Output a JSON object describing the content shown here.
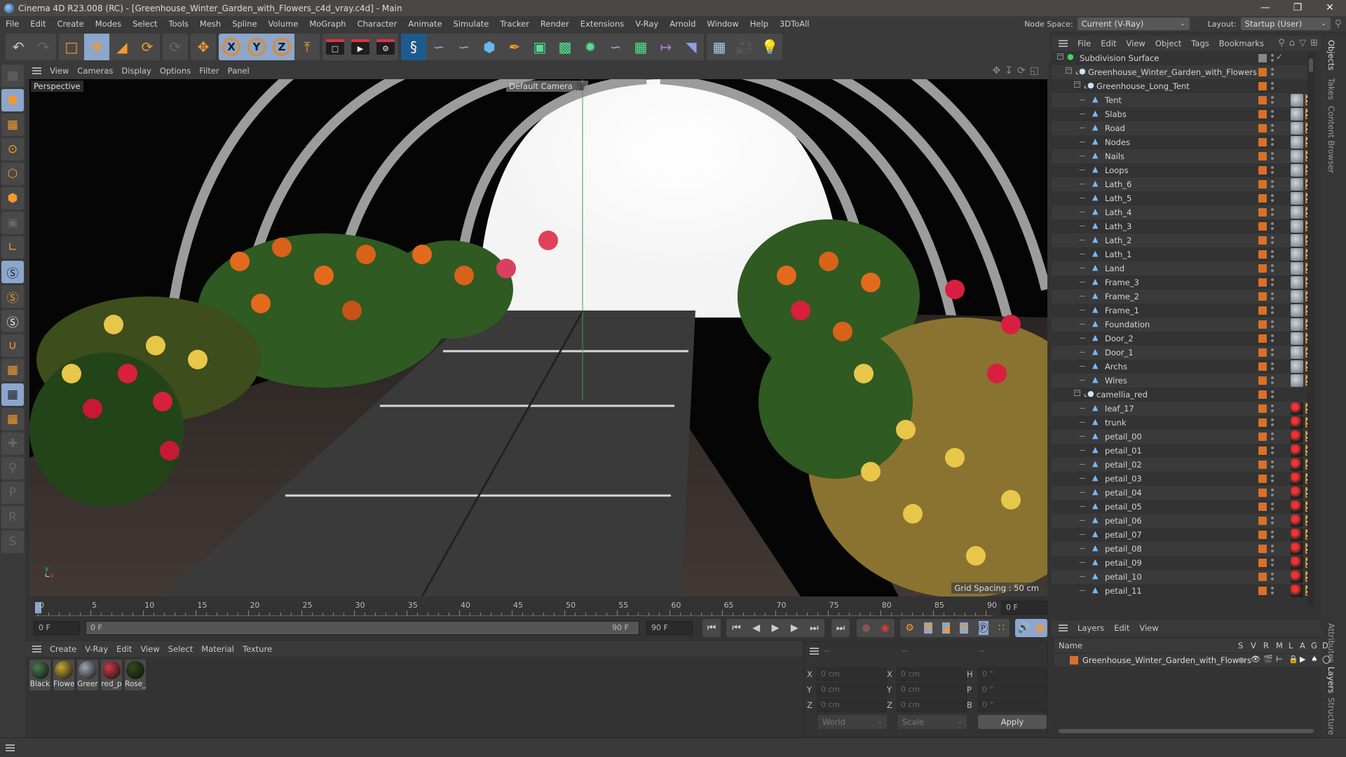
{
  "window": {
    "title": "Cinema 4D R23.008 (RC) - [Greenhouse_Winter_Garden_with_Flowers_c4d_vray.c4d] - Main",
    "controls": [
      "minimize",
      "restore",
      "close"
    ]
  },
  "menubar": {
    "items": [
      "File",
      "Edit",
      "Create",
      "Modes",
      "Select",
      "Tools",
      "Mesh",
      "Spline",
      "Volume",
      "MoGraph",
      "Character",
      "Animate",
      "Simulate",
      "Tracker",
      "Render",
      "Extensions",
      "V-Ray",
      "Arnold",
      "Window",
      "Help",
      "3DToAll"
    ],
    "node_space_label": "Node Space:",
    "node_space_value": "Current (V-Ray)",
    "layout_label": "Layout:",
    "layout_value": "Startup (User)"
  },
  "toolbar": {
    "groups": [
      [
        "undo-icon",
        "redo-icon"
      ],
      [
        "live-selection-icon",
        "move-icon",
        "scale-icon",
        "rotate-icon"
      ],
      [
        "psr-icon"
      ],
      [
        "axis-move-icon"
      ],
      [
        "x-axis-lock-icon",
        "y-axis-lock-icon",
        "z-axis-lock-icon",
        "coordinate-system-icon"
      ],
      [
        "render-view-icon",
        "render-picture-viewer-icon",
        "render-settings-icon"
      ],
      [
        "vray-icon",
        "python-icon",
        "python-icon",
        "cube-icon",
        "pen-icon",
        "subdivision-icon",
        "extrude-icon",
        "cloner-icon",
        "python-icon",
        "mograph-icon",
        "symmetry-icon",
        "deformer-icon"
      ],
      [
        "floor-icon",
        "camera-icon",
        "light-icon"
      ]
    ],
    "axis_labels": [
      "X",
      "Y",
      "Z"
    ]
  },
  "left_tools": [
    "make-editable-icon",
    "model-mode-icon",
    "texture-mode-icon",
    "point-mode-icon",
    "edge-mode-icon",
    "polygon-mode-icon",
    "uv-mode-icon",
    "axis-mode-icon",
    "snap-icon",
    "snap-settings-icon",
    "snap-quantize-icon",
    "magnet-icon",
    "workplane-icon",
    "locked-workplane-icon",
    "workplane-align-icon",
    "add-pin-icon",
    "pin-icon",
    "pin-p-icon",
    "pin-r-icon",
    "pin-s-icon"
  ],
  "viewport": {
    "menu": [
      "View",
      "Cameras",
      "Display",
      "Options",
      "Filter",
      "Panel"
    ],
    "view_name": "Perspective",
    "camera": "Default Camera",
    "grid_spacing": "Grid Spacing : 50 cm",
    "nav_icons": [
      "move-view-icon",
      "zoom-view-icon",
      "rotate-view-icon",
      "maximize-view-icon"
    ]
  },
  "timeline": {
    "ticks": [
      "0",
      "5",
      "10",
      "15",
      "20",
      "25",
      "30",
      "35",
      "40",
      "45",
      "50",
      "55",
      "60",
      "65",
      "70",
      "75",
      "80",
      "85",
      "90"
    ],
    "current_frame": "0 F",
    "start_field": "0 F",
    "range_start": "0 F",
    "range_end": "90 F",
    "end_field": "90 F"
  },
  "transport": {
    "buttons": [
      "go-to-start-icon",
      "prev-key-icon",
      "prev-frame-icon",
      "play-icon",
      "next-frame-icon",
      "next-key-icon",
      "go-to-end-icon",
      "record-key-icon",
      "autokey-icon",
      "keyframe-settings-icon",
      "key-position-icon",
      "key-scale-icon",
      "key-rotation-icon",
      "key-param-icon",
      "key-pla-icon",
      "sound-icon",
      "timeline-icon"
    ]
  },
  "materials": {
    "menu": [
      "Create",
      "V-Ray",
      "Edit",
      "View",
      "Select",
      "Material",
      "Texture"
    ],
    "items": [
      {
        "label": "Black",
        "color": "#4d7a4a"
      },
      {
        "label": "Flowe",
        "color": "#c9a833"
      },
      {
        "label": "Greer",
        "color": "#9aa7b0"
      },
      {
        "label": "red_p",
        "color": "#d03a48"
      },
      {
        "label": "Rose_",
        "color": "#2f4a1a"
      }
    ]
  },
  "coordinates": {
    "header": [
      "--",
      "--",
      "--"
    ],
    "position": [
      {
        "axis": "X",
        "value": "0 cm"
      },
      {
        "axis": "Y",
        "value": "0 cm"
      },
      {
        "axis": "Z",
        "value": "0 cm"
      }
    ],
    "size": [
      {
        "axis": "X",
        "value": "0 cm"
      },
      {
        "axis": "Y",
        "value": "0 cm"
      },
      {
        "axis": "Z",
        "value": "0 cm"
      }
    ],
    "rotation": [
      {
        "axis": "H",
        "value": "0 °"
      },
      {
        "axis": "P",
        "value": "0 °"
      },
      {
        "axis": "B",
        "value": "0 °"
      }
    ],
    "space": "World",
    "mode": "Scale",
    "apply_label": "Apply"
  },
  "object_manager": {
    "menu": [
      "File",
      "Edit",
      "View",
      "Object",
      "Tags",
      "Bookmarks"
    ],
    "objects": [
      {
        "name": "Subdivision Surface",
        "level": 0,
        "type": "subdivision",
        "tags": "check"
      },
      {
        "name": "Greenhouse_Winter_Garden_with_Flowers",
        "level": 1,
        "type": "null",
        "tags": "none"
      },
      {
        "name": "Greenhouse_Long_Tent",
        "level": 2,
        "type": "null",
        "tags": "none"
      },
      {
        "name": "Tent",
        "level": 3,
        "type": "mesh",
        "tags": "grey"
      },
      {
        "name": "Slabs",
        "level": 3,
        "type": "mesh",
        "tags": "grey"
      },
      {
        "name": "Road",
        "level": 3,
        "type": "mesh",
        "tags": "grey"
      },
      {
        "name": "Nodes",
        "level": 3,
        "type": "mesh",
        "tags": "grey"
      },
      {
        "name": "Nails",
        "level": 3,
        "type": "mesh",
        "tags": "grey"
      },
      {
        "name": "Loops",
        "level": 3,
        "type": "mesh",
        "tags": "grey"
      },
      {
        "name": "Lath_6",
        "level": 3,
        "type": "mesh",
        "tags": "grey"
      },
      {
        "name": "Lath_5",
        "level": 3,
        "type": "mesh",
        "tags": "grey"
      },
      {
        "name": "Lath_4",
        "level": 3,
        "type": "mesh",
        "tags": "grey"
      },
      {
        "name": "Lath_3",
        "level": 3,
        "type": "mesh",
        "tags": "grey"
      },
      {
        "name": "Lath_2",
        "level": 3,
        "type": "mesh",
        "tags": "grey"
      },
      {
        "name": "Lath_1",
        "level": 3,
        "type": "mesh",
        "tags": "grey"
      },
      {
        "name": "Land",
        "level": 3,
        "type": "mesh",
        "tags": "grey"
      },
      {
        "name": "Frame_3",
        "level": 3,
        "type": "mesh",
        "tags": "grey"
      },
      {
        "name": "Frame_2",
        "level": 3,
        "type": "mesh",
        "tags": "grey"
      },
      {
        "name": "Frame_1",
        "level": 3,
        "type": "mesh",
        "tags": "grey"
      },
      {
        "name": "Foundation",
        "level": 3,
        "type": "mesh",
        "tags": "grey"
      },
      {
        "name": "Door_2",
        "level": 3,
        "type": "mesh",
        "tags": "grey"
      },
      {
        "name": "Door_1",
        "level": 3,
        "type": "mesh",
        "tags": "grey"
      },
      {
        "name": "Archs",
        "level": 3,
        "type": "mesh",
        "tags": "grey"
      },
      {
        "name": "Wires",
        "level": 3,
        "type": "mesh",
        "tags": "grey"
      },
      {
        "name": "camellia_red",
        "level": 2,
        "type": "null",
        "tags": "none"
      },
      {
        "name": "leaf_17",
        "level": 3,
        "type": "mesh",
        "tags": "red"
      },
      {
        "name": "trunk",
        "level": 3,
        "type": "mesh",
        "tags": "red"
      },
      {
        "name": "petail_00",
        "level": 3,
        "type": "mesh",
        "tags": "red"
      },
      {
        "name": "petail_01",
        "level": 3,
        "type": "mesh",
        "tags": "red"
      },
      {
        "name": "petail_02",
        "level": 3,
        "type": "mesh",
        "tags": "red"
      },
      {
        "name": "petail_03",
        "level": 3,
        "type": "mesh",
        "tags": "red"
      },
      {
        "name": "petail_04",
        "level": 3,
        "type": "mesh",
        "tags": "red"
      },
      {
        "name": "petail_05",
        "level": 3,
        "type": "mesh",
        "tags": "red"
      },
      {
        "name": "petail_06",
        "level": 3,
        "type": "mesh",
        "tags": "red"
      },
      {
        "name": "petail_07",
        "level": 3,
        "type": "mesh",
        "tags": "red"
      },
      {
        "name": "petail_08",
        "level": 3,
        "type": "mesh",
        "tags": "red"
      },
      {
        "name": "petail_09",
        "level": 3,
        "type": "mesh",
        "tags": "red"
      },
      {
        "name": "petail_10",
        "level": 3,
        "type": "mesh",
        "tags": "red"
      },
      {
        "name": "petail_11",
        "level": 3,
        "type": "mesh",
        "tags": "red"
      }
    ]
  },
  "side_tabs_top": [
    "Objects",
    "Takes",
    "Content Browser"
  ],
  "side_tabs_bottom": [
    "Attributes",
    "Layers",
    "Structure"
  ],
  "layer_manager": {
    "menu": [
      "Layers",
      "Edit",
      "View"
    ],
    "columns": [
      "Name",
      "S",
      "V",
      "R",
      "M",
      "L",
      "A",
      "G",
      "D"
    ],
    "layers": [
      {
        "name": "Greenhouse_Winter_Garden_with_Flowers",
        "color": "#d8702a"
      }
    ]
  },
  "colors": {
    "accent_blue": "#8ca6cc",
    "accent_orange": "#f29a2e",
    "layer_orange": "#d8702a"
  }
}
